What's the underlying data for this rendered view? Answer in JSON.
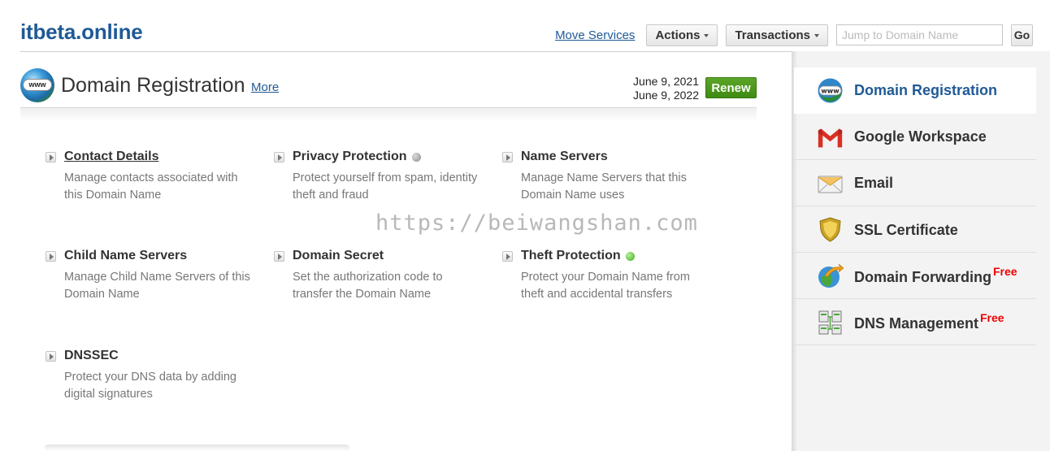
{
  "header": {
    "site_title": "itbeta.online",
    "move_services": "Move Services",
    "actions_label": "Actions",
    "transactions_label": "Transactions",
    "jump_placeholder": "Jump to Domain Name",
    "go_label": "Go"
  },
  "panel": {
    "title": "Domain Registration",
    "more_label": "More",
    "date_start": "June 9, 2021",
    "date_end": "June 9, 2022",
    "renew_label": "Renew"
  },
  "options": [
    {
      "name": "Contact Details",
      "desc": "Manage contacts associated with this Domain Name",
      "status": "",
      "is_link": true
    },
    {
      "name": "Privacy Protection",
      "desc": "Protect yourself from spam, identity theft and fraud",
      "status": "grey-dot-icon"
    },
    {
      "name": "Name Servers",
      "desc": "Manage Name Servers that this Domain Name uses",
      "status": ""
    },
    {
      "name": "Child Name Servers",
      "desc": "Manage Child Name Servers of this Domain Name",
      "status": ""
    },
    {
      "name": "Domain Secret",
      "desc": "Set the authorization code to transfer the Domain Name",
      "status": ""
    },
    {
      "name": "Theft Protection",
      "desc": "Protect your Domain Name from theft and accidental transfers",
      "status": "green-dot-icon"
    },
    {
      "name": "DNSSEC",
      "desc": "Protect your DNS data by adding digital signatures",
      "status": ""
    }
  ],
  "watermark": "https://beiwangshan.com",
  "sidebar": {
    "items": [
      {
        "label": "Domain Registration",
        "icon": "www-globe-icon",
        "free": ""
      },
      {
        "label": "Google Workspace",
        "icon": "gmail-icon",
        "free": ""
      },
      {
        "label": "Email",
        "icon": "envelope-icon",
        "free": ""
      },
      {
        "label": "SSL Certificate",
        "icon": "shield-icon",
        "free": ""
      },
      {
        "label": "Domain Forwarding",
        "icon": "forwarding-globe-icon",
        "free": "Free"
      },
      {
        "label": "DNS Management",
        "icon": "dns-servers-icon",
        "free": "Free"
      }
    ]
  },
  "colors": {
    "brand_blue": "#1f5a96",
    "renew_green": "#4a9a1d",
    "free_red": "#ee0000"
  }
}
